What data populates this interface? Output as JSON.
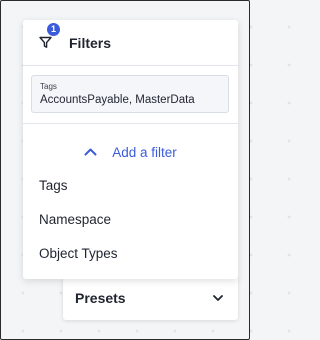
{
  "filter_panel": {
    "title": "Filters",
    "badge_count": "1",
    "active_filter": {
      "label": "Tags",
      "value": "AccountsPayable, MasterData"
    },
    "add_filter_label": "Add a filter",
    "options": [
      {
        "label": "Tags"
      },
      {
        "label": "Namespace"
      },
      {
        "label": "Object Types"
      }
    ]
  },
  "presets": {
    "label": "Presets"
  },
  "icons": {
    "filter": "funnel-icon",
    "collapse": "chevron-up-icon",
    "dropdown": "chevron-down-icon"
  },
  "colors": {
    "accent": "#3b5bdb",
    "badge_bg": "#3b5bdb",
    "chip_bg": "#f4f6fa",
    "text": "#1f2430"
  }
}
